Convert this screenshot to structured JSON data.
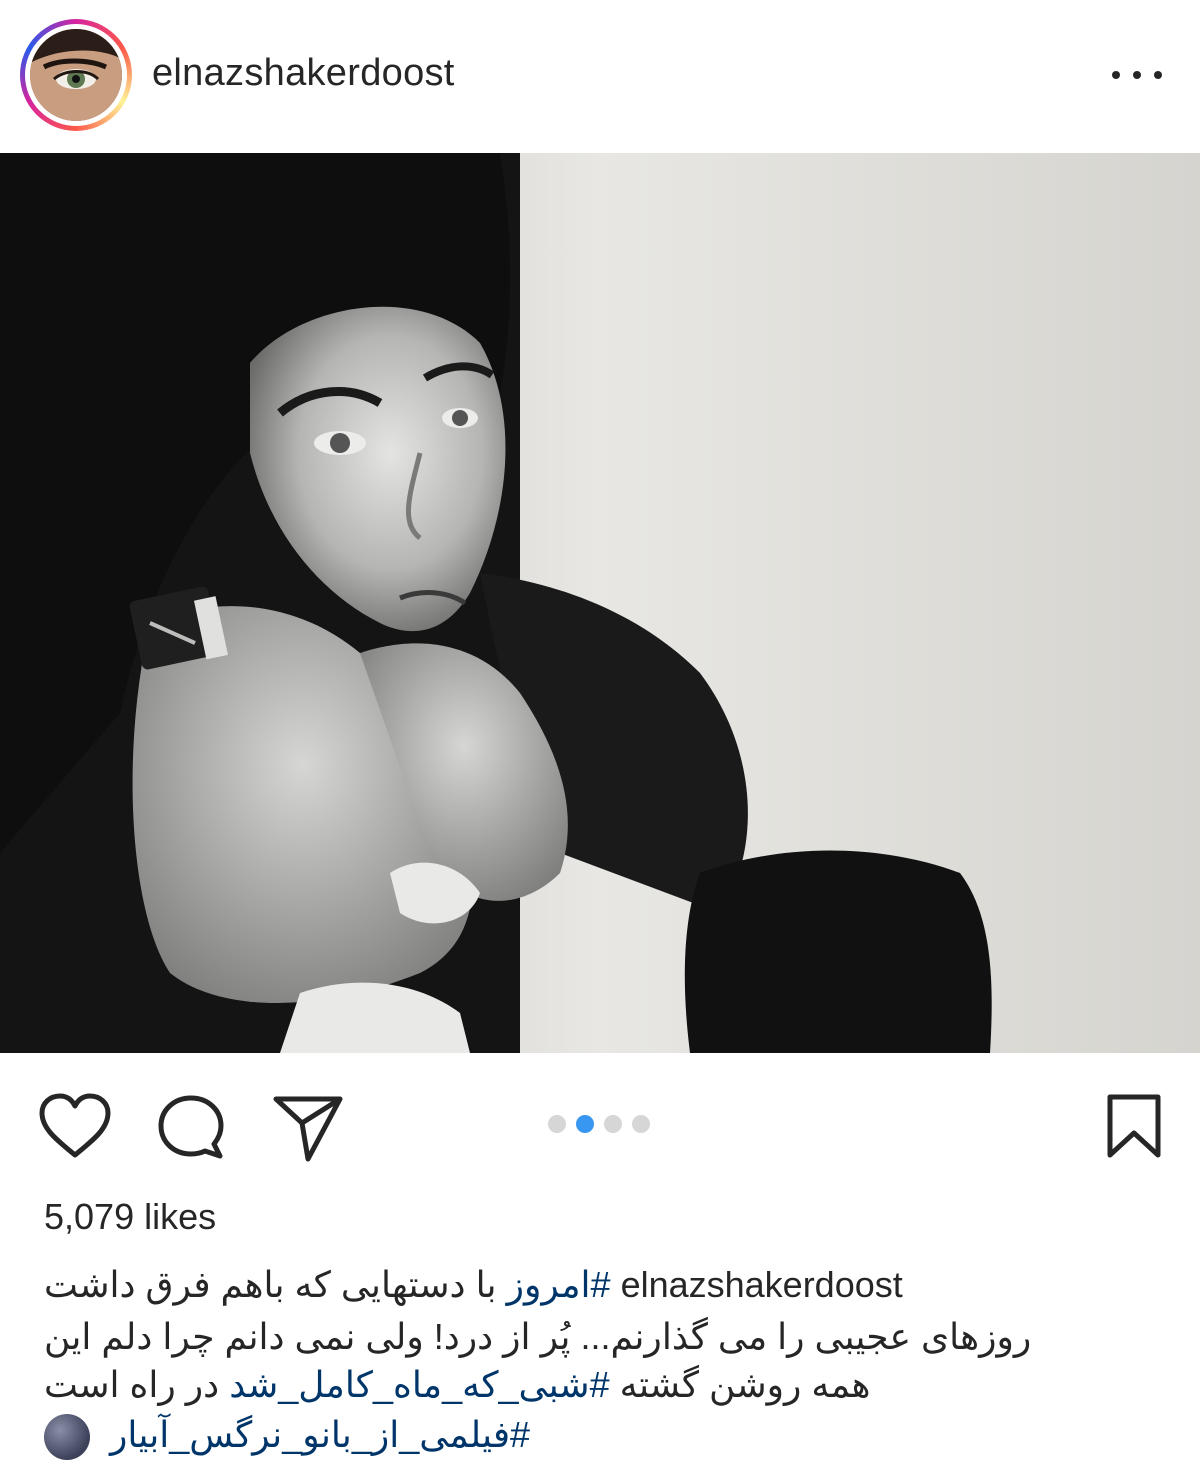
{
  "header": {
    "username": "elnazshakerdoost",
    "avatar_icon": "profile-avatar",
    "more_icon": "more-horizontal-icon"
  },
  "post": {
    "image_icon": "post-photo",
    "carousel": {
      "total": 4,
      "active_index": 1
    }
  },
  "actions": {
    "like_icon": "heart-icon",
    "comment_icon": "comment-icon",
    "share_icon": "send-icon",
    "save_icon": "bookmark-icon"
  },
  "likes_text": "5,079 likes",
  "caption": {
    "username": "elnazshakerdoost",
    "line1_tag": "#امروز",
    "line1_text": "با دستهایی که باهم فرق داشت",
    "line2_text": "روزهای عجیبی را می گذارنم... پُر از درد! ولی نمی دانم چرا دلم این",
    "line3_prefix": "همه روشن گشته",
    "line3_tag": "#شبی_که_ماه_کامل_شد",
    "line3_suffix": "در راه است",
    "line4_tag": "#فیلمی_از_بانو_نرگس_آبیار",
    "emoji_icon": "new-moon-face-emoji"
  },
  "colors": {
    "text": "#262626",
    "hashtag": "#003569",
    "pager_active": "#3897f0",
    "pager_inactive": "#d6d6d6"
  }
}
